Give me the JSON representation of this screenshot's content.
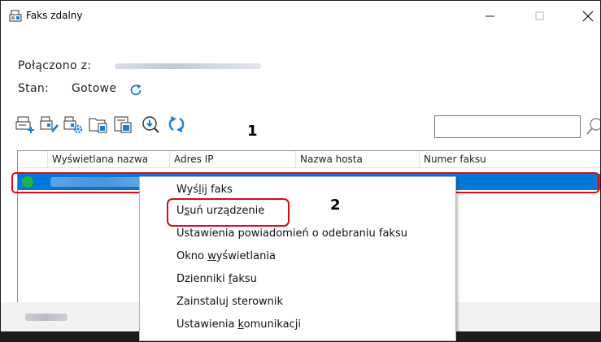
{
  "window": {
    "title": "Faks zdalny",
    "icon": "fax-icon",
    "controls": [
      "minimize-icon",
      "maximize-icon",
      "close-icon"
    ]
  },
  "status": {
    "connected_label": "Połączono z:",
    "state_label": "Stan:",
    "state_value": "Gotowe"
  },
  "toolbar": {
    "icons": [
      "add-device-icon",
      "edit-device-icon",
      "device-settings-icon",
      "fax-log-icon",
      "fax-list-icon",
      "find-device-icon",
      "refresh-icon"
    ],
    "step_marker": "1"
  },
  "table": {
    "columns": [
      "Wyświetlana nazwa",
      "Adres IP",
      "Nazwa hosta",
      "Numer faksu"
    ],
    "rows": [
      {
        "status": "online",
        "selected": true
      }
    ]
  },
  "context_menu": {
    "items": [
      {
        "label_pre": "Wyś",
        "label_u": "l",
        "label_post": "ij faks"
      },
      {
        "label_pre": "U",
        "label_u": "s",
        "label_post": "uń urządzenie"
      },
      {
        "label_pre": "Ustawienia powiadomień o odebraniu faksu",
        "label_u": "",
        "label_post": ""
      },
      {
        "label_pre": "Okno ",
        "label_u": "w",
        "label_post": "yświetlania"
      },
      {
        "label_pre": "Dzienniki ",
        "label_u": "f",
        "label_post": "aksu"
      },
      {
        "label_pre": "Zainstaluj sterownik",
        "label_u": "",
        "label_post": ""
      },
      {
        "label_pre": "Ustawienia ",
        "label_u": "k",
        "label_post": "omunikacji"
      }
    ],
    "step_marker": "2"
  },
  "colors": {
    "selection": "#0078d7",
    "highlight": "#e30613",
    "status_online": "#20b14d",
    "accent_icon": "#1a7fd6"
  }
}
